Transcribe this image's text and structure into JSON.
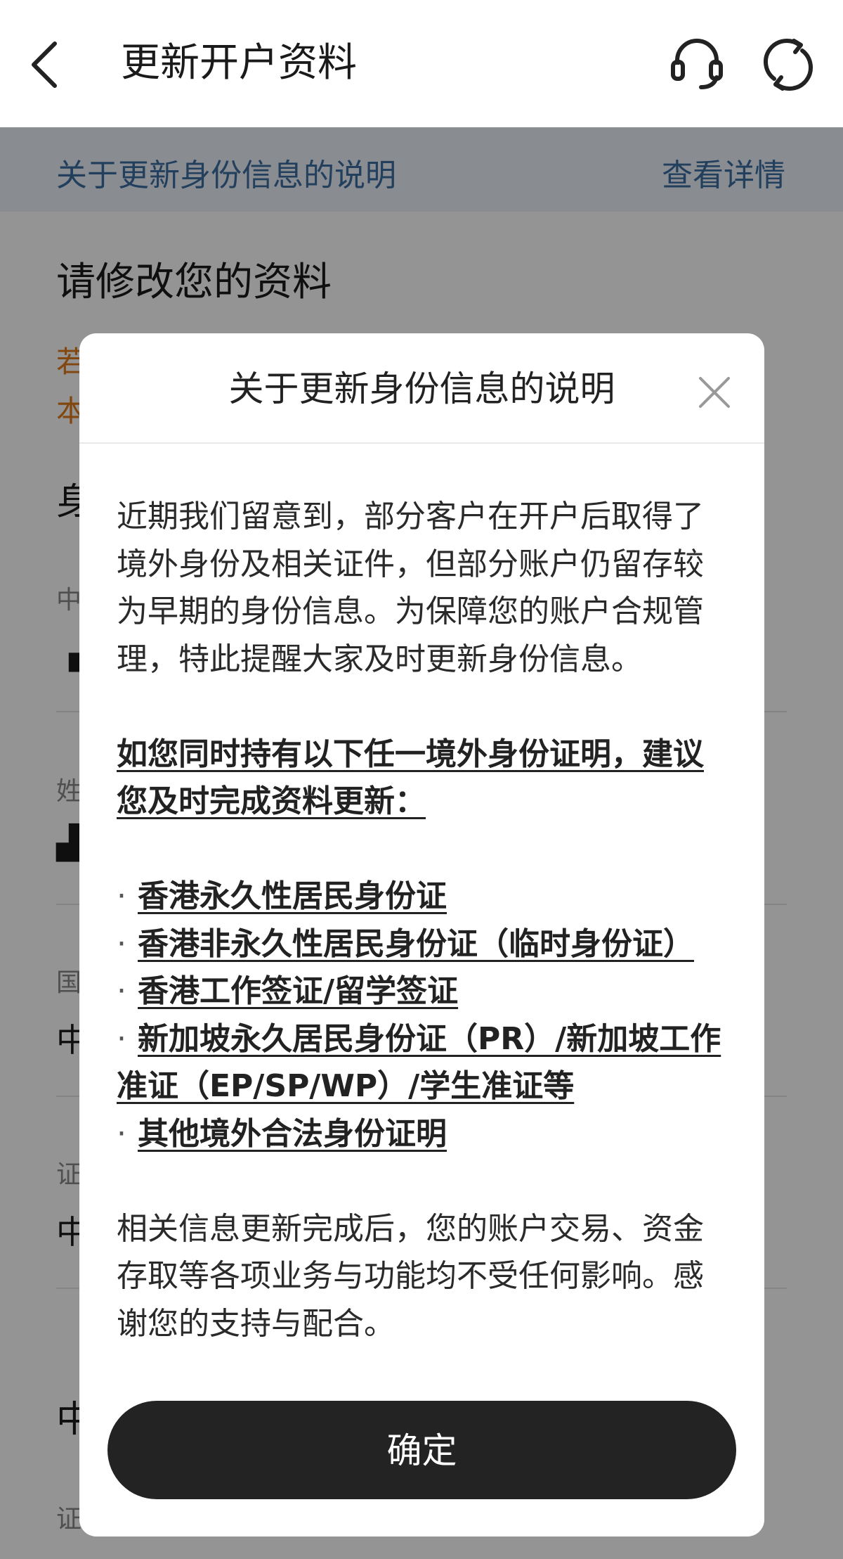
{
  "nav": {
    "title": "更新开户资料",
    "back_icon": "chevron-left-icon",
    "support_icon": "headset-icon",
    "refresh_icon": "refresh-icon"
  },
  "notice": {
    "text": "关于更新身份信息的说明",
    "link": "查看详情"
  },
  "page": {
    "section_title": "请修改您的资料",
    "warn_line1": "若",
    "warn_line2": "本",
    "heading_partial": "身",
    "fields": [
      {
        "label": "中",
        "value": "▗"
      },
      {
        "label": "姓",
        "value": "▟"
      },
      {
        "label": "国",
        "value": "中"
      },
      {
        "label": "证",
        "value": "中"
      }
    ],
    "bottom_heading": "中",
    "bottom_label": "证"
  },
  "modal": {
    "title": "关于更新身份信息的说明",
    "close_icon": "close-icon",
    "para1": "近期我们留意到，部分客户在开户后取得了境外身份及相关证件，但部分账户仍留存较为早期的身份信息。为保障您的账户合规管理，特此提醒大家及时更新身份信息。",
    "para2": "如您同时持有以下任一境外身份证明，建议您及时完成资料更新：",
    "bullet_char": "·",
    "bullets": [
      "香港永久性居民身份证",
      "香港非永久性居民身份证（临时身份证）",
      "香港工作签证/留学签证",
      "新加坡永久居民身份证（PR）/新加坡工作准证（EP/SP/WP）/学生准证等",
      "其他境外合法身份证明"
    ],
    "para3": "相关信息更新完成后，您的账户交易、资金存取等各项业务与功能均不受任何影响。感谢您的支持与配合。",
    "confirm_label": "确定"
  },
  "colors": {
    "overlay": "#00000069",
    "notice_text": "#3b6ea3",
    "warning": "#e07a1b",
    "button": "#232323"
  }
}
